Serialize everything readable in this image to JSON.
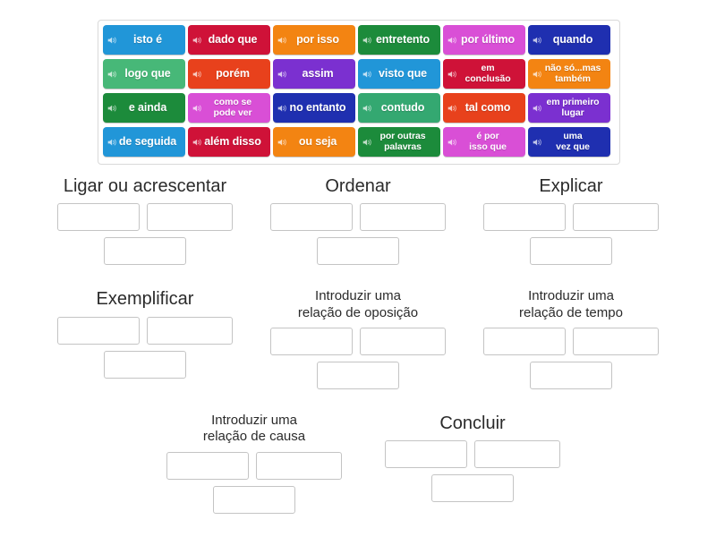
{
  "activity": {
    "type": "group-sort",
    "language": "pt"
  },
  "tray": {
    "name": "word-tile-tray",
    "tiles": [
      {
        "label": "isto é",
        "color": "#2196d8",
        "icon": "speaker-icon",
        "multiline": false
      },
      {
        "label": "dado que",
        "color": "#cf1238",
        "icon": "speaker-icon",
        "multiline": false
      },
      {
        "label": "por isso",
        "color": "#f38412",
        "icon": "speaker-icon",
        "multiline": false
      },
      {
        "label": "entretento",
        "color": "#1c8b3b",
        "icon": "speaker-icon",
        "multiline": false
      },
      {
        "label": "por último",
        "color": "#d94fd6",
        "icon": "speaker-icon",
        "multiline": false
      },
      {
        "label": "quando",
        "color": "#1f2fb0",
        "icon": "speaker-icon",
        "multiline": false
      },
      {
        "label": "logo que",
        "color": "#47b878",
        "icon": "speaker-icon",
        "multiline": false
      },
      {
        "label": "porém",
        "color": "#e8411c",
        "icon": "speaker-icon",
        "multiline": false
      },
      {
        "label": "assim",
        "color": "#7b30d0",
        "icon": "speaker-icon",
        "multiline": false
      },
      {
        "label": "visto que",
        "color": "#2196d8",
        "icon": "speaker-icon",
        "multiline": false
      },
      {
        "label": "em\nconclusão",
        "color": "#cf1238",
        "icon": "speaker-icon",
        "multiline": true
      },
      {
        "label": "não só...mas\ntambém",
        "color": "#f38412",
        "icon": "speaker-icon",
        "multiline": true
      },
      {
        "label": "e ainda",
        "color": "#1c8b3b",
        "icon": "speaker-icon",
        "multiline": false
      },
      {
        "label": "como se\npode ver",
        "color": "#d94fd6",
        "icon": "speaker-icon",
        "multiline": true
      },
      {
        "label": "no entanto",
        "color": "#1f2fb0",
        "icon": "speaker-icon",
        "multiline": false
      },
      {
        "label": "contudo",
        "color": "#34a871",
        "icon": "speaker-icon",
        "multiline": false
      },
      {
        "label": "tal como",
        "color": "#e8411c",
        "icon": "speaker-icon",
        "multiline": false
      },
      {
        "label": "em primeiro\nlugar",
        "color": "#7b30d0",
        "icon": "speaker-icon",
        "multiline": true
      },
      {
        "label": "de seguida",
        "color": "#2196d8",
        "icon": "speaker-icon",
        "multiline": false
      },
      {
        "label": "além disso",
        "color": "#cf1238",
        "icon": "speaker-icon",
        "multiline": false
      },
      {
        "label": "ou seja",
        "color": "#f38412",
        "icon": "speaker-icon",
        "multiline": false
      },
      {
        "label": "por outras\npalavras",
        "color": "#1c8b3b",
        "icon": "speaker-icon",
        "multiline": true
      },
      {
        "label": "é por\nisso que",
        "color": "#d94fd6",
        "icon": "speaker-icon",
        "multiline": true
      },
      {
        "label": "uma\nvez que",
        "color": "#1f2fb0",
        "icon": "speaker-icon",
        "multiline": true
      }
    ]
  },
  "groups": {
    "rows": [
      [
        {
          "title": "Ligar ou acrescentar",
          "lines": 1,
          "slots_top": [
            "",
            ""
          ],
          "slots_bottom": [
            ""
          ]
        },
        {
          "title": "Ordenar",
          "lines": 1,
          "slots_top": [
            "",
            ""
          ],
          "slots_bottom": [
            ""
          ]
        },
        {
          "title": "Explicar",
          "lines": 1,
          "slots_top": [
            "",
            ""
          ],
          "slots_bottom": [
            ""
          ]
        }
      ],
      [
        {
          "title": "Exemplificar",
          "lines": 1,
          "slots_top": [
            "",
            ""
          ],
          "slots_bottom": [
            ""
          ]
        },
        {
          "title": "Introduzir uma\nrelação de oposição",
          "lines": 2,
          "slots_top": [
            "",
            ""
          ],
          "slots_bottom": [
            ""
          ]
        },
        {
          "title": "Introduzir uma\nrelação de tempo",
          "lines": 2,
          "slots_top": [
            "",
            ""
          ],
          "slots_bottom": [
            ""
          ]
        }
      ],
      [
        {
          "title": "Introduzir uma\nrelação de causa",
          "lines": 2,
          "slots_top": [
            "",
            ""
          ],
          "slots_bottom": [
            ""
          ]
        },
        {
          "title": "Concluir",
          "lines": 1,
          "slots_top": [
            "",
            ""
          ],
          "slots_bottom": [
            ""
          ]
        }
      ]
    ]
  },
  "colors": {
    "tray_border": "#d9d9d9",
    "slot_border": "#c4c4c4",
    "page_background": "#ffffff",
    "title_text": "#2b2b2b",
    "tile_text": "#ffffff"
  }
}
